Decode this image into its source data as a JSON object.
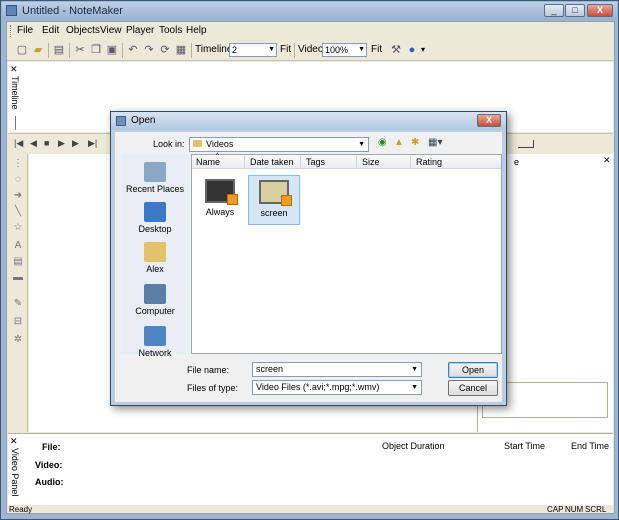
{
  "window": {
    "title": "Untitled - NoteMaker",
    "controls": {
      "minimize": "_",
      "maximize": "□",
      "close": "X"
    }
  },
  "menu": {
    "items": [
      {
        "label": "File"
      },
      {
        "label": "Edit"
      },
      {
        "label": "Objects"
      },
      {
        "label": "View"
      },
      {
        "label": "Player"
      },
      {
        "label": "Tools"
      },
      {
        "label": "Help"
      }
    ]
  },
  "toolbar": {
    "timeline_label": "Timeline:",
    "timeline_value": "2",
    "fit1": "Fit",
    "video_label": "Video",
    "zoom_value": "100%",
    "fit2": "Fit",
    "icons": [
      "new-icon",
      "open-icon",
      "save-icon",
      "cut-icon",
      "copy-icon",
      "paste-icon",
      "undo-icon",
      "redo-icon",
      "refresh-icon",
      "grid-icon",
      "tools-icon",
      "help-icon"
    ]
  },
  "panels": {
    "timeline_title": "Timeline",
    "video_panel_title": "Video Panel"
  },
  "video_panel": {
    "file_label": "File:",
    "video_label": "Video:",
    "audio_label": "Audio:",
    "columns": [
      "Object Duration",
      "Start Time",
      "End Time"
    ]
  },
  "status": {
    "text": "Ready",
    "indicators": [
      "CAP",
      "NUM",
      "SCRL"
    ]
  },
  "dialog": {
    "title": "Open",
    "look_in_label": "Look in:",
    "look_in_value": "Videos",
    "places": [
      {
        "label": "Recent Places",
        "icon": "recent-places-icon",
        "color": "#8aa7c6"
      },
      {
        "label": "Desktop",
        "icon": "desktop-icon",
        "color": "#3a78c8"
      },
      {
        "label": "Alex",
        "icon": "user-folder-icon",
        "color": "#e2c26a"
      },
      {
        "label": "Computer",
        "icon": "computer-icon",
        "color": "#5c7fa6"
      },
      {
        "label": "Network",
        "icon": "network-icon",
        "color": "#4d86c3"
      }
    ],
    "columns": [
      "Name",
      "Date taken",
      "Tags",
      "Size",
      "Rating"
    ],
    "files": [
      {
        "name": "Always",
        "selected": false
      },
      {
        "name": "screen",
        "selected": true
      }
    ],
    "file_name_label": "File name:",
    "file_name_value": "screen",
    "file_type_label": "Files of type:",
    "file_type_value": "Video Files (*.avi;*.mpg;*.wmv)",
    "open_button": "Open",
    "cancel_button": "Cancel",
    "close": "X"
  }
}
